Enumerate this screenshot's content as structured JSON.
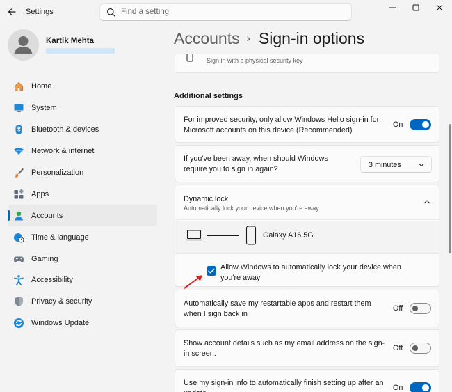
{
  "window": {
    "app_title": "Settings"
  },
  "search": {
    "placeholder": "Find a setting"
  },
  "profile": {
    "name": "Kartik Mehta"
  },
  "sidebar": {
    "items": [
      {
        "label": "Home",
        "icon": "home-icon"
      },
      {
        "label": "System",
        "icon": "system-icon"
      },
      {
        "label": "Bluetooth & devices",
        "icon": "bluetooth-icon"
      },
      {
        "label": "Network & internet",
        "icon": "wifi-icon"
      },
      {
        "label": "Personalization",
        "icon": "brush-icon"
      },
      {
        "label": "Apps",
        "icon": "apps-icon"
      },
      {
        "label": "Accounts",
        "icon": "accounts-icon",
        "active": true
      },
      {
        "label": "Time & language",
        "icon": "globe-clock-icon"
      },
      {
        "label": "Gaming",
        "icon": "gamepad-icon"
      },
      {
        "label": "Accessibility",
        "icon": "accessibility-icon"
      },
      {
        "label": "Privacy & security",
        "icon": "shield-icon"
      },
      {
        "label": "Windows Update",
        "icon": "update-icon"
      }
    ]
  },
  "breadcrumb": {
    "parent": "Accounts",
    "separator": "›",
    "current": "Sign-in options"
  },
  "security_key": {
    "subtitle": "Sign in with a physical security key"
  },
  "additional": {
    "title": "Additional settings",
    "hello_only": {
      "text": "For improved security, only allow Windows Hello sign-in for Microsoft accounts on this device (Recommended)",
      "state": "On",
      "on": true
    },
    "away": {
      "text": "If you've been away, when should Windows require you to sign in again?",
      "value": "3 minutes"
    },
    "dynamic_lock": {
      "title": "Dynamic lock",
      "subtitle": "Automatically lock your device when you're away",
      "device": "Galaxy A16 5G",
      "checkbox_label": "Allow Windows to automatically lock your device when you're away",
      "checked": true
    },
    "restart_apps": {
      "text": "Automatically save my restartable apps and restart them when I sign back in",
      "state": "Off",
      "on": false
    },
    "account_details": {
      "text": "Show account details such as my email address on the sign-in screen.",
      "state": "Off",
      "on": false
    },
    "signin_info": {
      "text": "Use my sign-in info to automatically finish setting up after an update",
      "state": "On",
      "on": true
    }
  },
  "colors": {
    "accent": "#0067c0",
    "annotation_arrow": "#e02020"
  }
}
